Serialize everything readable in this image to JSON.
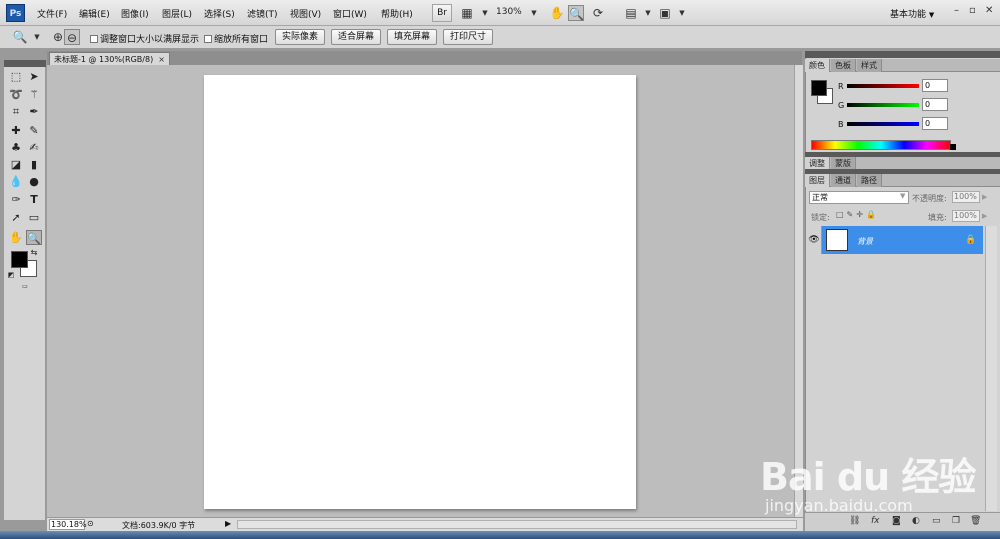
{
  "app": {
    "logo_text": "Ps"
  },
  "menu": {
    "items": [
      "文件(F)",
      "编辑(E)",
      "图像(I)",
      "图层(L)",
      "选择(S)",
      "滤镜(T)",
      "视图(V)",
      "窗口(W)",
      "帮助(H)"
    ],
    "bridge_label": "Br",
    "zoom": "130%",
    "workspace": "基本功能",
    "workspace_caret": "▼"
  },
  "window_controls": {
    "minimize": "–",
    "restore": "▫",
    "close": "✕"
  },
  "options": {
    "resize_windows_label": "调整窗口大小以满屏显示",
    "zoom_all_label": "缩放所有窗口",
    "actual_pixels": "实际像素",
    "fit_screen": "适合屏幕",
    "fill_screen": "填充屏幕",
    "print_size": "打印尺寸"
  },
  "document": {
    "tab_title": "未标题-1 @ 130%(RGB/8)",
    "tab_close": "×",
    "zoom_field": "130.18%",
    "doc_info": "文档:603.9K/0 字节"
  },
  "color_panel": {
    "tabs": [
      "颜色",
      "色板",
      "样式"
    ],
    "channels": [
      {
        "label": "R",
        "value": "0",
        "color": "#d40000"
      },
      {
        "label": "G",
        "value": "0",
        "color": "#00a000"
      },
      {
        "label": "B",
        "value": "0",
        "color": "#0000c8"
      }
    ]
  },
  "adjust_panel": {
    "tabs": [
      "调整",
      "蒙版"
    ]
  },
  "layers_panel": {
    "tabs": [
      "图层",
      "通道",
      "路径"
    ],
    "blend_mode": "正常",
    "opacity_label": "不透明度:",
    "opacity_value": "100%",
    "lock_label": "锁定:",
    "fill_label": "填充:",
    "fill_value": "100%",
    "layer_name": "背景"
  },
  "watermark": {
    "brand": "Bai  du 经验",
    "url": "jingyan.baidu.com"
  },
  "colors": {
    "selection": "#3d8ee8",
    "foreground": "#000000",
    "background": "#ffffff"
  }
}
